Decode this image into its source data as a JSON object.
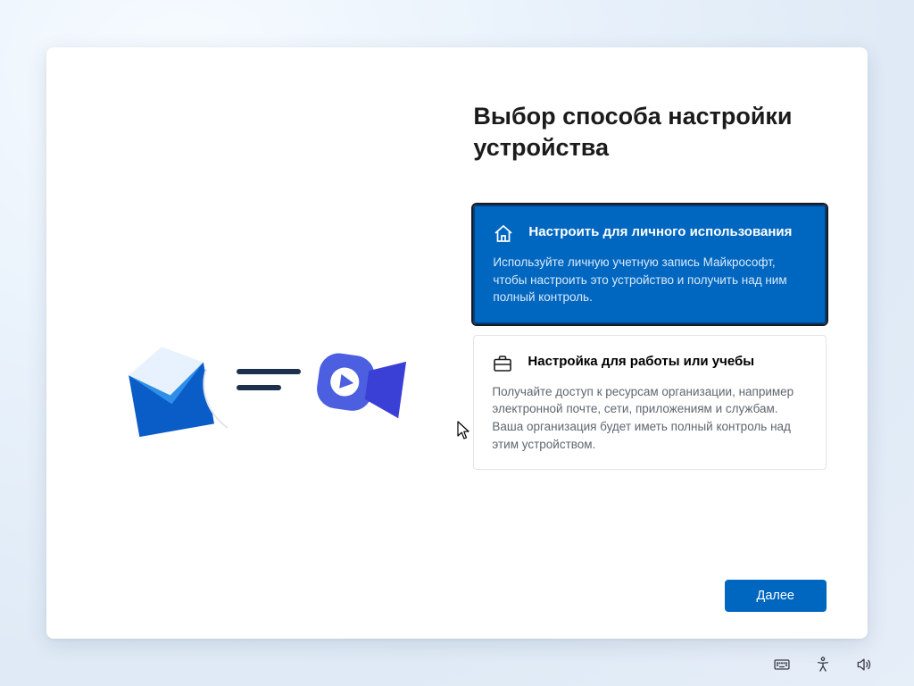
{
  "title": "Выбор способа настройки устройства",
  "options": [
    {
      "title": "Настроить для личного использования",
      "desc": "Используйте личную учетную запись Майкрософт, чтобы настроить это устройство и получить над ним полный контроль.",
      "selected": true
    },
    {
      "title": "Настройка для работы или учебы",
      "desc": "Получайте доступ к ресурсам организации, например электронной почте, сети, приложениям и службам. Ваша организация будет иметь полный контроль над этим устройством.",
      "selected": false
    }
  ],
  "next_label": "Далее"
}
